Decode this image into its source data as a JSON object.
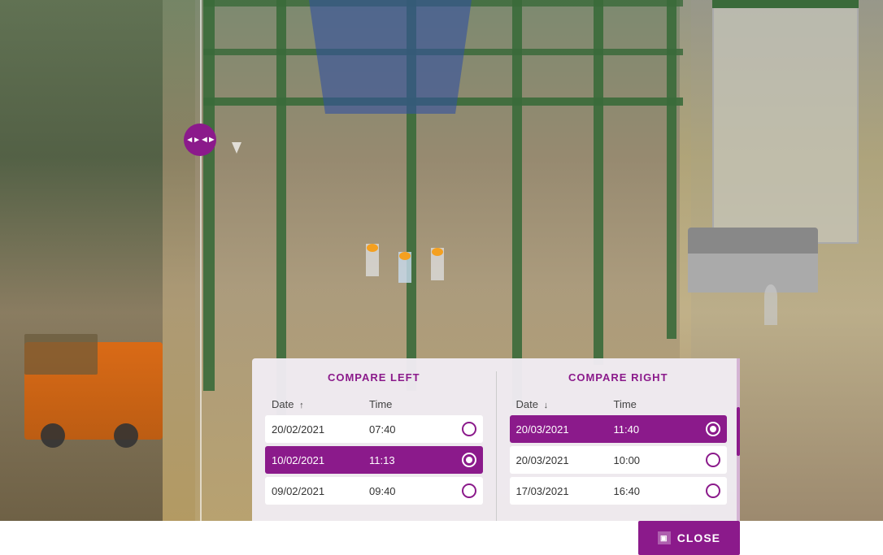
{
  "background": {
    "alt": "Construction site timelapse comparison"
  },
  "splitter": {
    "icon": "◄►"
  },
  "modal": {
    "left_title": "COMPARE LEFT",
    "right_title": "COMPARE RIGHT",
    "left_col": {
      "date_header": "Date",
      "date_sort": "↑",
      "time_header": "Time",
      "rows": [
        {
          "date": "20/02/2021",
          "time": "07:40",
          "selected": false
        },
        {
          "date": "10/02/2021",
          "time": "11:13",
          "selected": true
        },
        {
          "date": "09/02/2021",
          "time": "09:40",
          "selected": false
        }
      ]
    },
    "right_col": {
      "date_header": "Date",
      "date_sort": "↓",
      "time_header": "Time",
      "rows": [
        {
          "date": "20/03/2021",
          "time": "11:40",
          "selected": true
        },
        {
          "date": "20/03/2021",
          "time": "10:00",
          "selected": false
        },
        {
          "date": "17/03/2021",
          "time": "16:40",
          "selected": false
        }
      ]
    },
    "close_button_label": "CLOSE"
  }
}
